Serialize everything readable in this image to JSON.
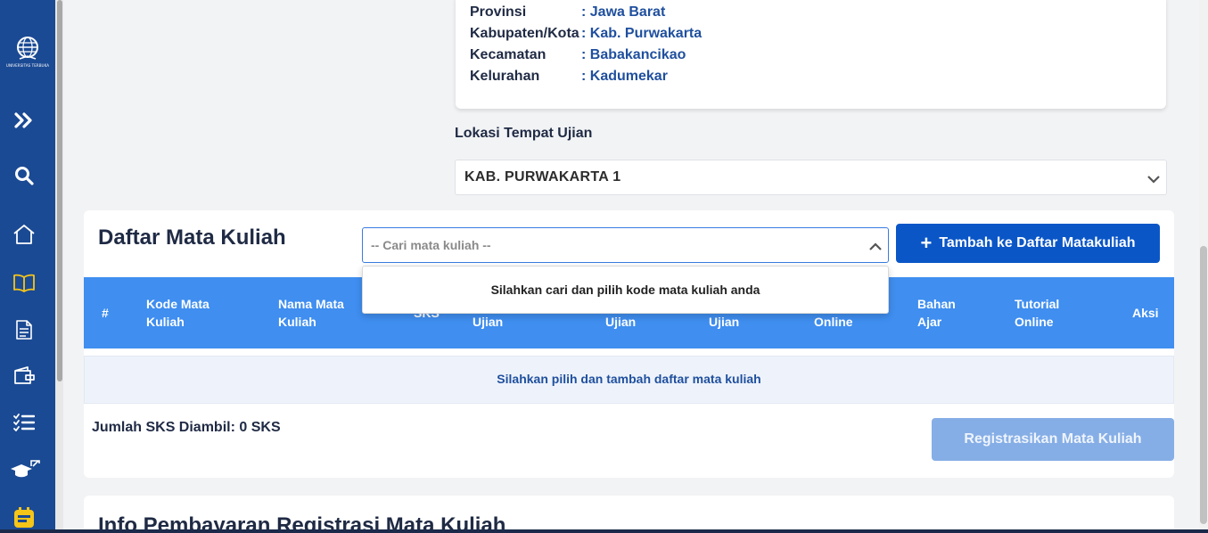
{
  "sidebar": {
    "logo_text": "UNIVERSITAS TERBUKA",
    "items": [
      {
        "icon": "expand-chevrons-icon"
      },
      {
        "icon": "search-icon"
      },
      {
        "icon": "home-icon"
      },
      {
        "icon": "book-icon"
      },
      {
        "icon": "document-icon"
      },
      {
        "icon": "wallet-icon"
      },
      {
        "icon": "checklist-icon"
      },
      {
        "icon": "graduation-cap-external-icon"
      },
      {
        "icon": "calendar-icon"
      }
    ],
    "accent_color": "#f5c518",
    "background_color": "#1b4a94"
  },
  "address": {
    "rows": [
      {
        "key": "Provinsi",
        "value": ": Jawa Barat"
      },
      {
        "key": "Kabupaten/Kota",
        "value": ": Kab. Purwakarta"
      },
      {
        "key": "Kecamatan",
        "value": ": Babakancikao"
      },
      {
        "key": "Kelurahan",
        "value": ": Kadumekar"
      }
    ]
  },
  "lokasi": {
    "label": "Lokasi Tempat Ujian",
    "selected": "KAB. PURWAKARTA 1"
  },
  "mata_kuliah": {
    "title": "Daftar Mata Kuliah",
    "search_placeholder": "-- Cari mata kuliah --",
    "add_button": "Tambah ke Daftar Matakuliah",
    "dropdown_message": "Silahkan cari dan pilih kode mata kuliah anda",
    "columns": {
      "num": "#",
      "kode_1": "Kode Mata",
      "kode_2": "Kuliah",
      "nama_1": "Nama Mata",
      "nama_2": "Kuliah",
      "sks": "SKS",
      "ujian_a": "Ujian",
      "ujian_b": "Ujian",
      "ujian_c": "Ujian",
      "online": "Online",
      "bahan_1": "Bahan",
      "bahan_2": "Ajar",
      "tutorial_1": "Tutorial",
      "tutorial_2": "Online",
      "aksi": "Aksi"
    },
    "empty_message": "Silahkan pilih dan tambah daftar mata kuliah",
    "sks_total": "Jumlah SKS Diambil: 0 SKS",
    "register_button": "Registrasikan Mata Kuliah"
  },
  "info": {
    "title": "Info Pembayaran Registrasi Mata Kuliah"
  }
}
